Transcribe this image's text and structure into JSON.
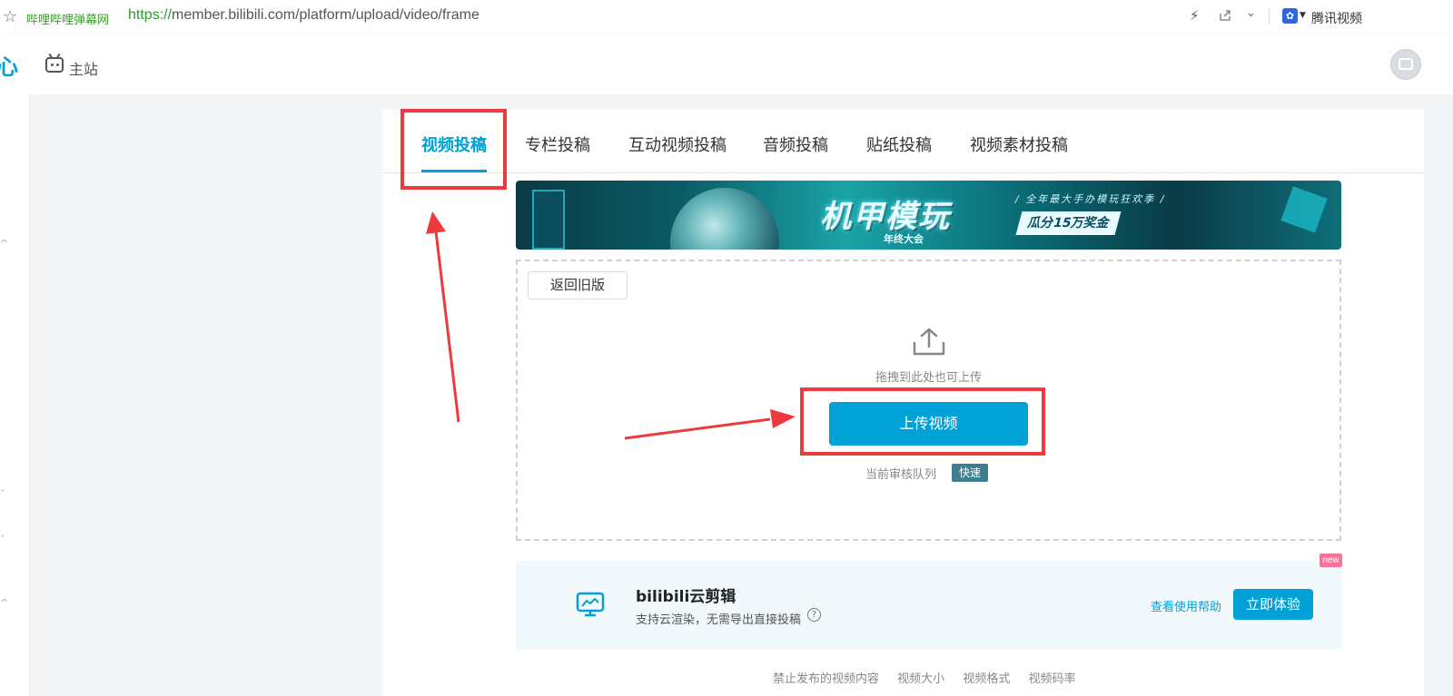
{
  "browser": {
    "site_name": "哔哩哔哩弹幕网",
    "url_protocol": "https://",
    "url_rest": "member.bilibili.com/platform/upload/video/frame",
    "extension_label": "腾讯视频"
  },
  "header": {
    "logo_fragment": "心",
    "home_label": "主站"
  },
  "tabs": [
    {
      "label": "视频投稿",
      "active": true
    },
    {
      "label": "专栏投稿"
    },
    {
      "label": "互动视频投稿"
    },
    {
      "label": "音频投稿"
    },
    {
      "label": "贴纸投稿"
    },
    {
      "label": "视频素材投稿"
    }
  ],
  "banner": {
    "title": "机甲模玩",
    "subtitle": "年终大会",
    "tagline": "/ 全年最大手办模玩狂欢季 /",
    "prize": "瓜分15万奖金"
  },
  "upload": {
    "old_version_label": "返回旧版",
    "drag_hint": "拖拽到此处也可上传",
    "upload_button": "上传视频",
    "queue_label": "当前审核队列",
    "queue_status": "快速"
  },
  "cloud_edit": {
    "badge": "new",
    "title": "bilibili云剪辑",
    "desc": "支持云渲染，无需导出直接投稿",
    "help_link": "查看使用帮助",
    "try_button": "立即体验"
  },
  "footer_links": [
    "禁止发布的视频内容",
    "视频大小",
    "视频格式",
    "视频码率"
  ],
  "colors": {
    "accent": "#00a1d6",
    "highlight": "#ee3a3d",
    "new_badge": "#fb7299"
  }
}
